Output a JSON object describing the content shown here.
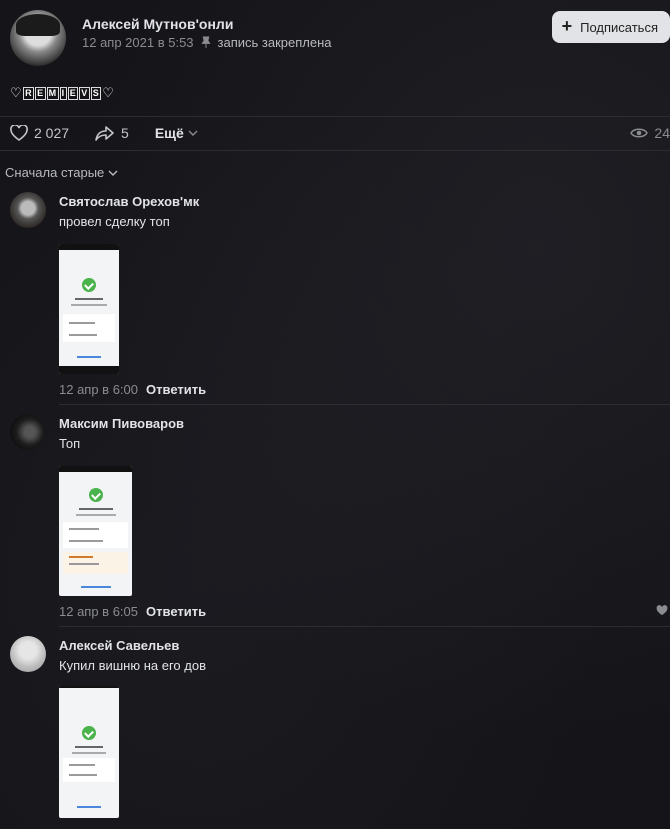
{
  "post": {
    "author": "Алексей Мутнов'онли",
    "date": "12 апр 2021 в 5:53",
    "pinned": "запись закреплена",
    "subscribe_label": "Подписаться",
    "text_prefix": "♡",
    "text_boxed": [
      "R",
      "E",
      "M",
      "I",
      "E",
      "V",
      "S"
    ],
    "text_suffix": "♡"
  },
  "actions": {
    "likes": "2 027",
    "shares": "5",
    "more": "Ещё",
    "views": "24"
  },
  "sort_label": "Сначала старые",
  "comments": [
    {
      "name": "Святослав Орехов'мк",
      "text": "провел сделку топ",
      "time": "12 апр в 6:00",
      "reply": "Ответить"
    },
    {
      "name": "Максим Пивоваров",
      "text": "Топ",
      "time": "12 апр в 6:05",
      "reply": "Ответить"
    },
    {
      "name": "Алексей Савельев",
      "text": "Купил вишню на его дов",
      "time": "",
      "reply": ""
    }
  ],
  "colors": {
    "background": "#151519",
    "text": "#e1e3e6",
    "muted": "#8a8c90",
    "button_bg": "#e1e3e6",
    "success": "#4bb34b"
  }
}
